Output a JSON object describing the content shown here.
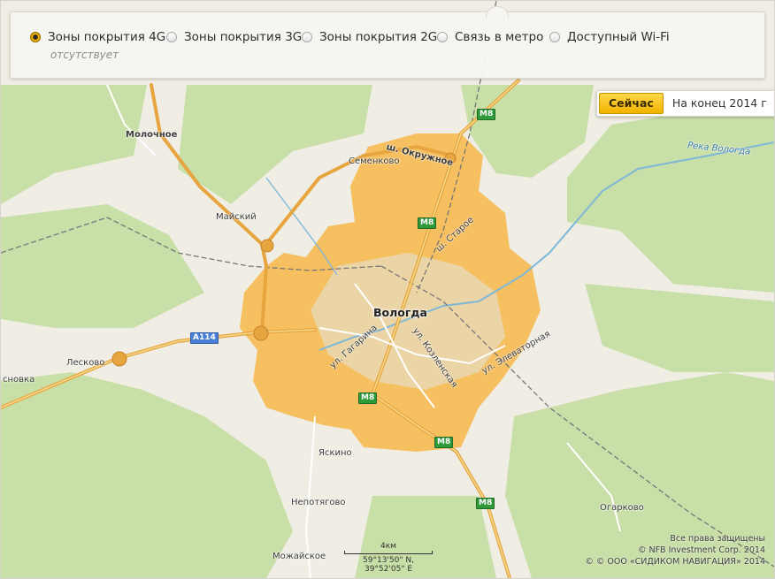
{
  "coverage_options": [
    {
      "label": "Зоны покрытия 4G",
      "selected": true
    },
    {
      "label": "Зоны покрытия 3G",
      "selected": false
    },
    {
      "label": "Зоны покрытия 2G",
      "selected": false
    },
    {
      "label": "Связь в метро",
      "selected": false
    },
    {
      "label": "Доступный Wi-Fi",
      "selected": false
    }
  ],
  "metro_status": "отсутствует",
  "time_toggle": {
    "now": "Сейчас",
    "end_2014": "На конец 2014 г",
    "active": "now"
  },
  "map": {
    "city": "Вологда",
    "places": {
      "molochnoe": "Молочное",
      "maysky": "Майский",
      "semenkovo": "Семенково",
      "leskovo": "Лесково",
      "snovka": "сновка",
      "yaskino": "Яскино",
      "nepotyagovo": "Непотягово",
      "mozhayskoe": "Можайское",
      "ogarkovo": "Огарково"
    },
    "streets": {
      "okruzhnoe": "ш. Окружное",
      "staroe": "ш. Старое",
      "gagarina": "ул. Гагарина",
      "kozlenskaya": "ул. Козленская",
      "elevatornaya": "ул. Элеваторная"
    },
    "river": "Река Вологда",
    "road_shields": {
      "m8": "M8",
      "a114": "A114"
    },
    "coverage_color": "#f7b23a"
  },
  "scale": {
    "distance": "4км",
    "coords": "59°13'50\" N, 39°52'05\" E"
  },
  "copyright": {
    "rights": "Все права защищены",
    "nfb": "© NFB Investment Corp. 2014",
    "sidikom": "© © ООО «СИДИКОМ НАВИГАЦИЯ» 2014"
  }
}
